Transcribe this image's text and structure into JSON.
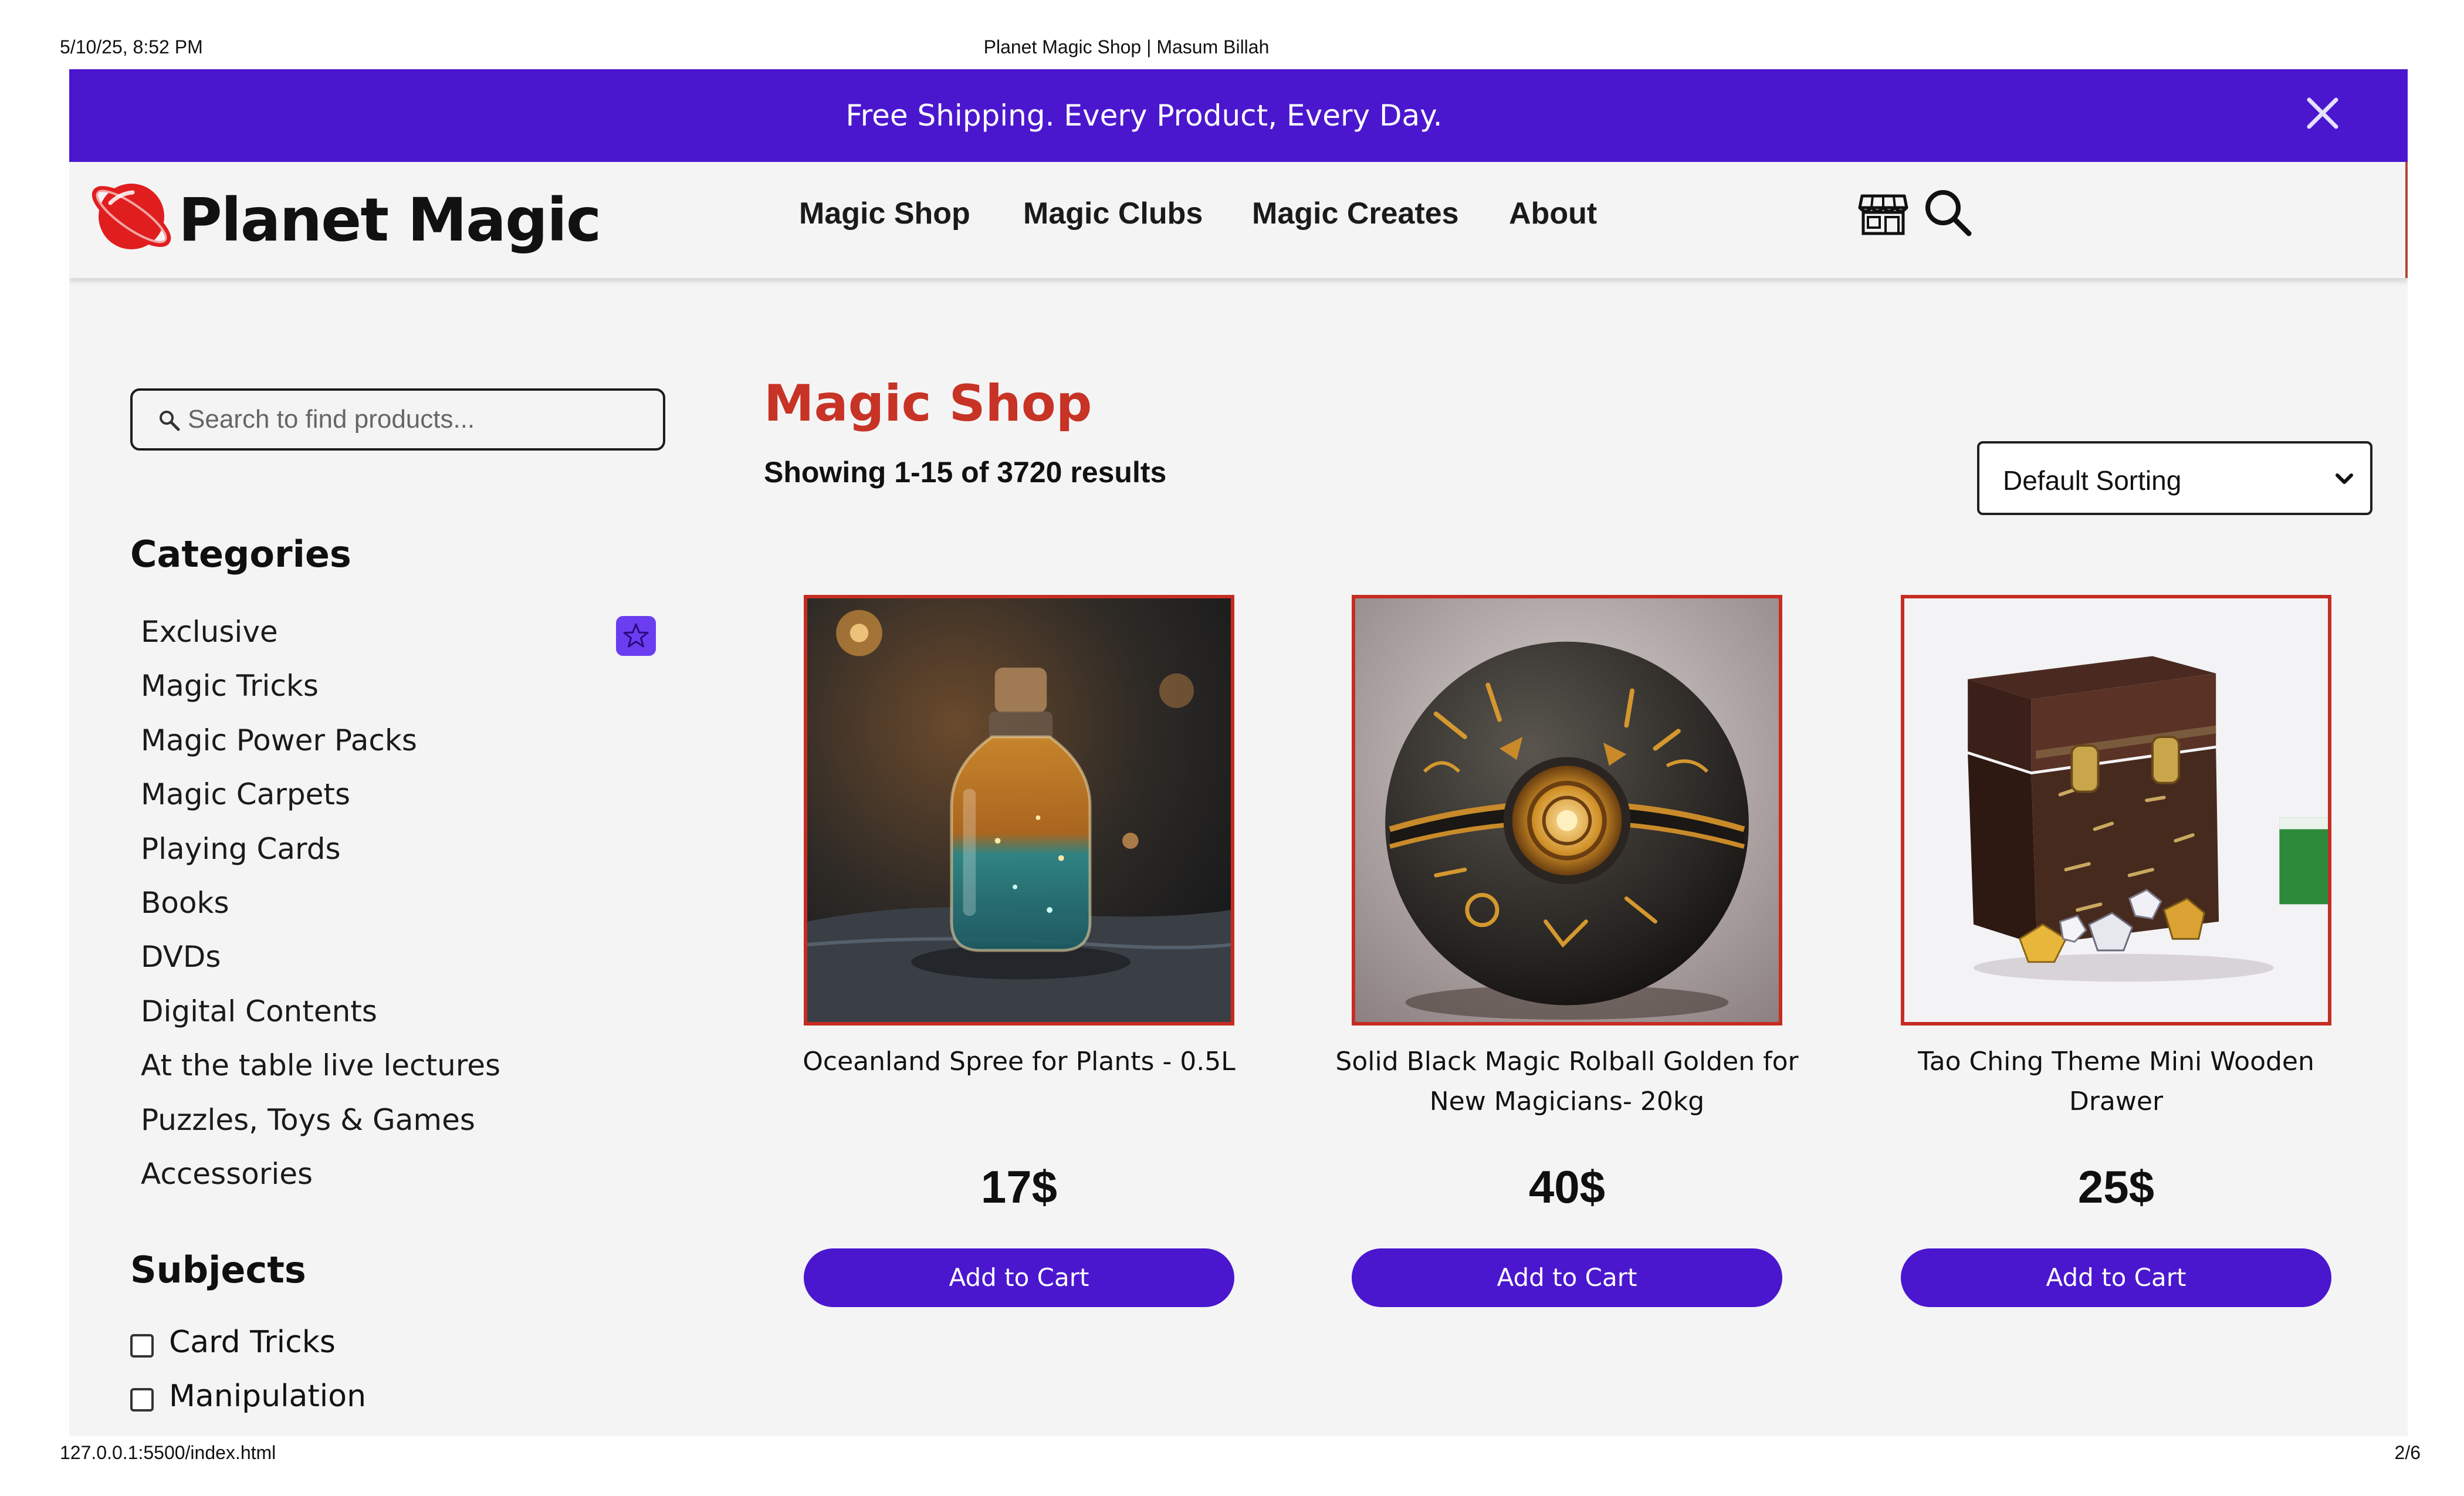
{
  "print_header": {
    "date": "5/10/25, 8:52 PM",
    "title": "Planet Magic Shop | Masum Billah"
  },
  "print_footer": {
    "url": "127.0.0.1:5500/index.html",
    "page": "2/6"
  },
  "promo": {
    "text": "Free Shipping. Every Product, Every Day.",
    "close_icon": "close-icon"
  },
  "brand": {
    "name": "Planet Magic",
    "logo_icon": "planet-logo-icon"
  },
  "nav": {
    "links": [
      "Magic Shop",
      "Magic Clubs",
      "Magic Creates",
      "About"
    ],
    "icons": [
      "store-icon",
      "search-icon"
    ]
  },
  "search": {
    "placeholder": "Search to find products..."
  },
  "sidebar": {
    "categories_heading": "Categories",
    "categories": [
      "Exclusive",
      "Magic Tricks",
      "Magic Power Packs",
      "Magic Carpets",
      "Playing Cards",
      "Books",
      "DVDs",
      "Digital Contents",
      "At the table live lectures",
      "Puzzles, Toys & Games",
      "Accessories"
    ],
    "exclusive_badge_icon": "star-icon",
    "subjects_heading": "Subjects",
    "subjects": [
      {
        "label": "Card Tricks",
        "checked": false
      },
      {
        "label": "Manipulation",
        "checked": false
      }
    ]
  },
  "main": {
    "title": "Magic Shop",
    "results": "Showing 1-15 of 3720 results",
    "sort": {
      "selected": "Default Sorting"
    }
  },
  "products": [
    {
      "name": "Oceanland Spree for Plants - 0.5L",
      "price": "17$",
      "button": "Add to Cart",
      "image": "potion-bottle"
    },
    {
      "name": "Solid Black Magic Rolball Golden for New Magicians- 20kg",
      "price": "40$",
      "button": "Add to Cart",
      "image": "magic-ball"
    },
    {
      "name": "Tao Ching Theme Mini Wooden Drawer",
      "price": "25$",
      "button": "Add to Cart",
      "image": "wooden-box"
    }
  ],
  "colors": {
    "accent": "#4a17cf",
    "heading_red": "#c73325",
    "image_border": "#c62d22",
    "page_bg": "#f4f4f5"
  }
}
